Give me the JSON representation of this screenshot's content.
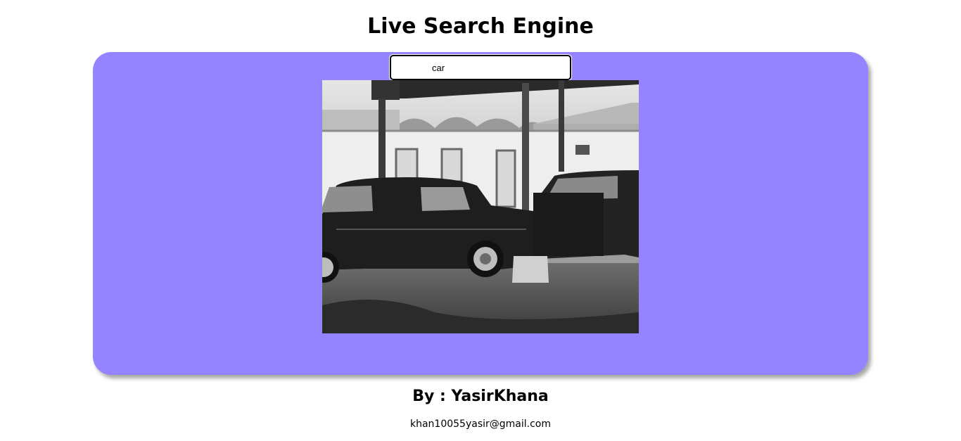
{
  "header": {
    "title": "Live Search Engine"
  },
  "search": {
    "value": "car",
    "placeholder": ""
  },
  "result": {
    "image_subject": "black-and-white photo of vintage cars parked under a carport"
  },
  "footer": {
    "author": "By : YasirKhana",
    "email": "khan10055yasir@gmail.com"
  },
  "colors": {
    "panel": "#9584ff",
    "background": "#ffffff",
    "text": "#000000"
  }
}
